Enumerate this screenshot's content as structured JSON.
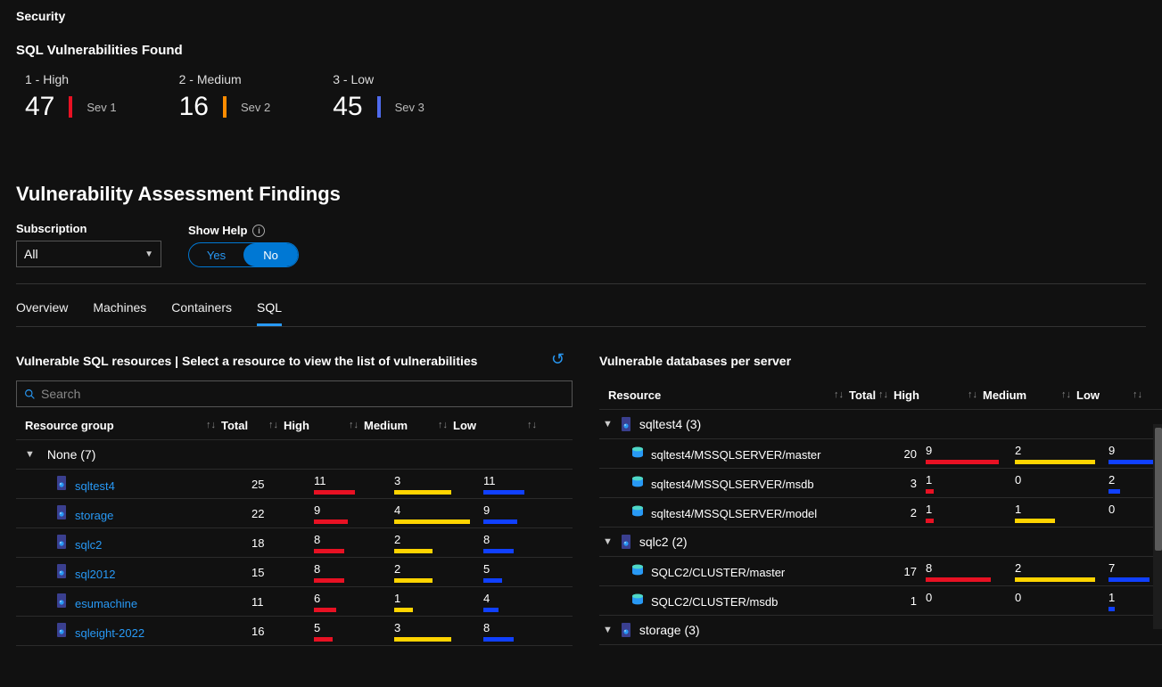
{
  "breadcrumb": "Security",
  "summary": {
    "title": "SQL Vulnerabilities Found",
    "items": [
      {
        "label": "1 - High",
        "value": "47",
        "sev": "Sev 1",
        "color": "#e81123"
      },
      {
        "label": "2 - Medium",
        "value": "16",
        "sev": "Sev 2",
        "color": "#ff8c00"
      },
      {
        "label": "3 - Low",
        "value": "45",
        "sev": "Sev 3",
        "color": "#4f6bed"
      }
    ]
  },
  "findings": {
    "title": "Vulnerability Assessment Findings",
    "subscription": {
      "label": "Subscription",
      "value": "All"
    },
    "show_help": {
      "label": "Show Help",
      "yes": "Yes",
      "no": "No"
    }
  },
  "tabs": [
    "Overview",
    "Machines",
    "Containers",
    "SQL"
  ],
  "active_tab": "SQL",
  "left_panel": {
    "title": "Vulnerable SQL resources | Select a resource to view the list of vulnerabilities",
    "search_placeholder": "Search",
    "headers": {
      "resource_group": "Resource group",
      "total": "Total",
      "high": "High",
      "medium": "Medium",
      "low": "Low"
    },
    "group": "None (7)",
    "rows": [
      {
        "name": "sqltest4",
        "total": "25",
        "h": "11",
        "m": "3",
        "l": "11",
        "hw": 46,
        "mw": 64,
        "lw": 46
      },
      {
        "name": "storage",
        "total": "22",
        "h": "9",
        "m": "4",
        "l": "9",
        "hw": 38,
        "mw": 85,
        "lw": 38
      },
      {
        "name": "sqlc2",
        "total": "18",
        "h": "8",
        "m": "2",
        "l": "8",
        "hw": 34,
        "mw": 43,
        "lw": 34
      },
      {
        "name": "sql2012",
        "total": "15",
        "h": "8",
        "m": "2",
        "l": "5",
        "hw": 34,
        "mw": 43,
        "lw": 21
      },
      {
        "name": "esumachine",
        "total": "11",
        "h": "6",
        "m": "1",
        "l": "4",
        "hw": 25,
        "mw": 21,
        "lw": 17
      },
      {
        "name": "sqleight-2022",
        "total": "16",
        "h": "5",
        "m": "3",
        "l": "8",
        "hw": 21,
        "mw": 64,
        "lw": 34
      }
    ]
  },
  "right_panel": {
    "title": "Vulnerable databases per server",
    "headers": {
      "resource": "Resource",
      "total": "Total",
      "high": "High",
      "medium": "Medium",
      "low": "Low"
    },
    "groups": [
      {
        "name": "sqltest4 (3)",
        "rows": [
          {
            "name": "sqltest4/MSSQLSERVER/master",
            "total": "20",
            "h": "9",
            "m": "2",
            "l": "9",
            "hw": 82,
            "mw": 90,
            "lw": 60
          },
          {
            "name": "sqltest4/MSSQLSERVER/msdb",
            "total": "3",
            "h": "1",
            "m": "0",
            "l": "2",
            "hw": 9,
            "mw": 0,
            "lw": 13
          },
          {
            "name": "sqltest4/MSSQLSERVER/model",
            "total": "2",
            "h": "1",
            "m": "1",
            "l": "0",
            "hw": 9,
            "mw": 45,
            "lw": 0
          }
        ]
      },
      {
        "name": "sqlc2 (2)",
        "rows": [
          {
            "name": "SQLC2/CLUSTER/master",
            "total": "17",
            "h": "8",
            "m": "2",
            "l": "7",
            "hw": 73,
            "mw": 90,
            "lw": 46
          },
          {
            "name": "SQLC2/CLUSTER/msdb",
            "total": "1",
            "h": "0",
            "m": "0",
            "l": "1",
            "hw": 0,
            "mw": 0,
            "lw": 7
          }
        ]
      },
      {
        "name": "storage (3)",
        "rows": []
      }
    ]
  }
}
